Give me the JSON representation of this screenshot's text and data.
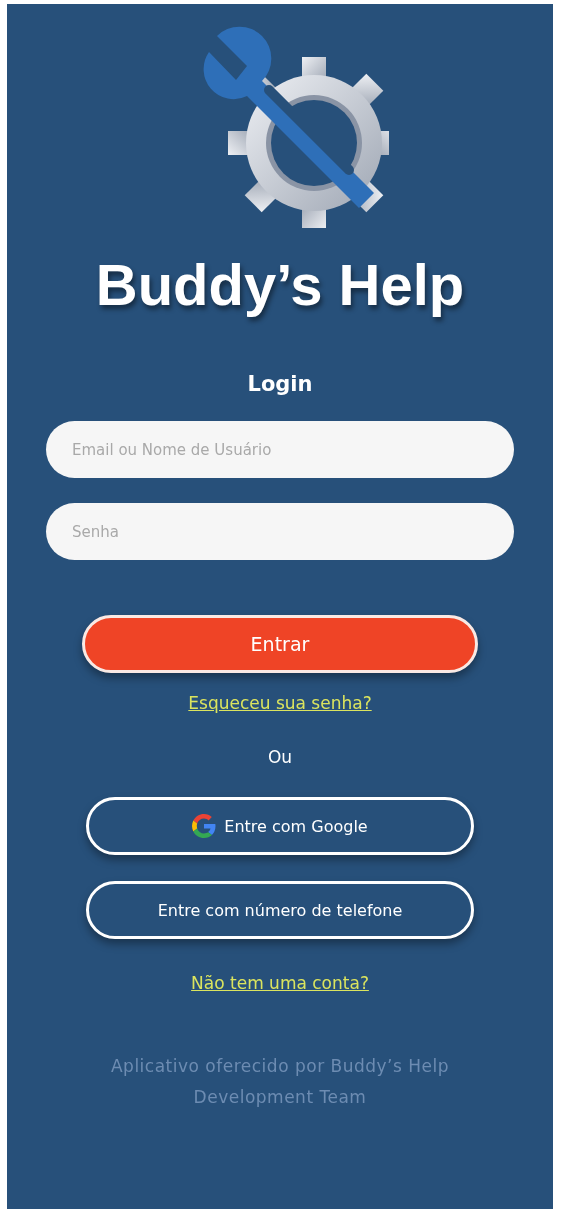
{
  "app_title": "Buddy’s Help",
  "heading": "Login",
  "fields": [
    {
      "placeholder": "Email ou Nome de Usuário"
    },
    {
      "placeholder": "Senha"
    }
  ],
  "login_button": "Entrar",
  "forgot_link": "Esqueceu sua senha?",
  "separator": "Ou",
  "social_buttons": [
    {
      "label": "Entre com Google",
      "kind": "google"
    },
    {
      "label": "Entre com número de telefone",
      "kind": "phone"
    }
  ],
  "signup_link": "Não tem uma conta?",
  "footer": [
    "Aplicativo oferecido por Buddy’s Help",
    "Development Team"
  ]
}
